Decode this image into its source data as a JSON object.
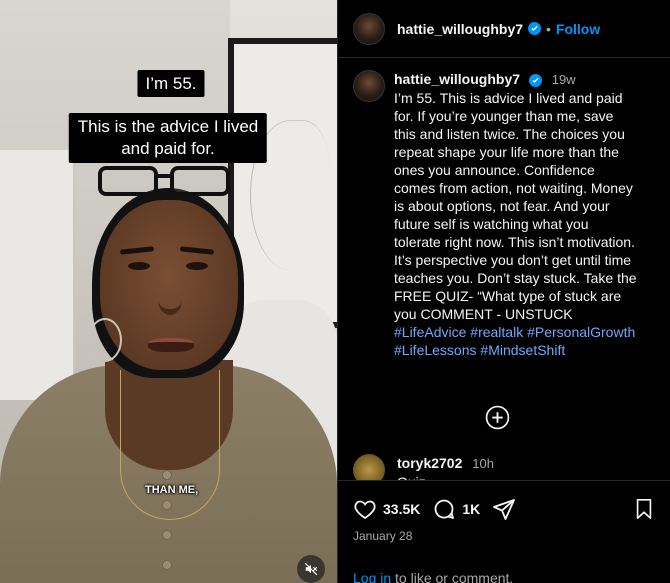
{
  "video": {
    "caption_line1": "I’m 55.",
    "caption_line2a": "This is the advice I lived",
    "caption_line2b": "and paid for.",
    "burned_subtitle": "THAN ME,",
    "mute_icon": "speaker-muted-icon"
  },
  "header": {
    "username": "hattie_willoughby7",
    "separator": "•",
    "follow_label": "Follow",
    "verified_icon": "verified-badge-icon"
  },
  "post": {
    "username": "hattie_willoughby7",
    "time": "19w",
    "caption_text": "I’m 55. This is advice I lived and paid for. If you’re younger than me, save this and listen twice. The choices you repeat shape your life more than the ones you announce. Confidence comes from action, not waiting. Money is about options, not fear. And your future self is watching what you tolerate right now. This isn’t motivation. It’s perspective you don’t get until time teaches you. Don’t stay stuck.  Take the FREE QUIZ- “What type of stuck are you COMMENT - UNSTUCK ",
    "hashtags": [
      "#LifeAdvice",
      "#realtalk",
      "#PersonalGrowth",
      "#LifeLessons",
      "#MindsetShift"
    ]
  },
  "load_more_icon": "plus-circle-icon",
  "comment": {
    "username": "toryk2702",
    "time": "10h",
    "text": "Quiz"
  },
  "footer": {
    "likes": "33.5K",
    "comments": "1K",
    "date": "January 28",
    "login_link": "Log in",
    "login_rest": " to like or comment."
  },
  "colors": {
    "background": "#000000",
    "accent": "#0095f6",
    "hashtag": "#6ea8ff",
    "muted_text": "#a8a8a8"
  }
}
